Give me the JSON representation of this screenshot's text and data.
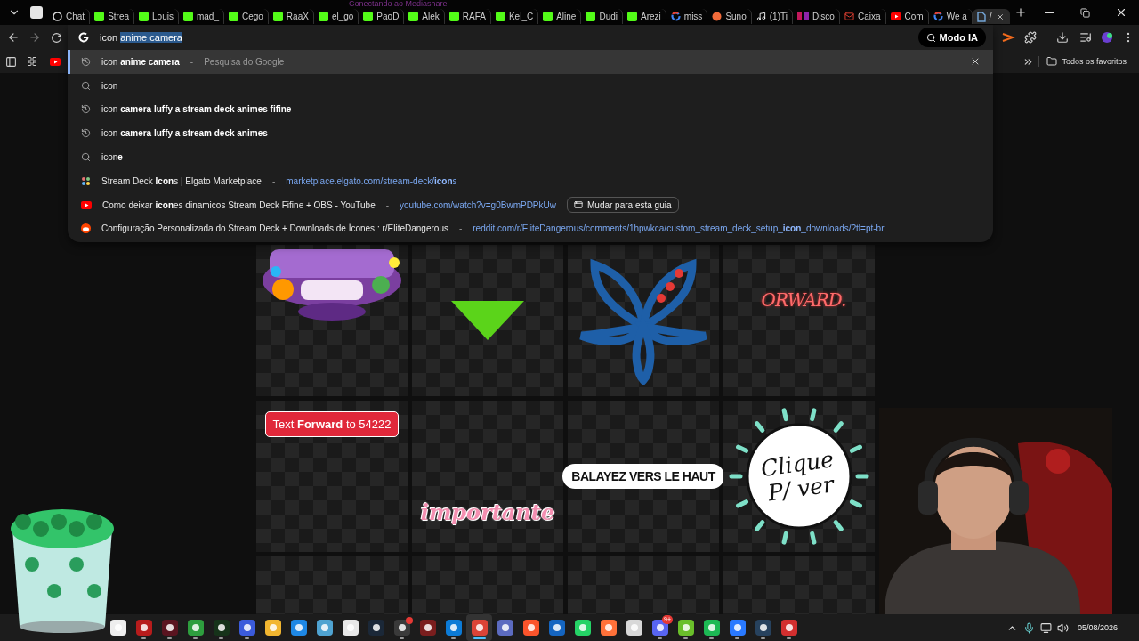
{
  "stream_overlay": {
    "notice": "Conectando ao Mediashare"
  },
  "tabs": [
    {
      "kind": "chatgpt",
      "title": "Chat",
      "selected": false
    },
    {
      "kind": "kick",
      "title": "Strea",
      "selected": false
    },
    {
      "kind": "kick",
      "title": "Louis",
      "selected": false
    },
    {
      "kind": "kick",
      "title": "mad_",
      "selected": false
    },
    {
      "kind": "kick",
      "title": "Cego",
      "selected": false
    },
    {
      "kind": "kick",
      "title": "RaaX",
      "selected": false
    },
    {
      "kind": "kick",
      "title": "el_go",
      "selected": false
    },
    {
      "kind": "kick",
      "title": "PaoD",
      "selected": false
    },
    {
      "kind": "kick",
      "title": "Alek",
      "selected": false
    },
    {
      "kind": "kick",
      "title": "RAFA",
      "selected": false
    },
    {
      "kind": "kick",
      "title": "Kel_C",
      "selected": false
    },
    {
      "kind": "kick",
      "title": "Aline",
      "selected": false
    },
    {
      "kind": "kick",
      "title": "Dudi",
      "selected": false
    },
    {
      "kind": "kick",
      "title": "Arezi",
      "selected": false
    },
    {
      "kind": "google",
      "title": "miss",
      "selected": false
    },
    {
      "kind": "suno",
      "title": "Suno",
      "selected": false
    },
    {
      "kind": "tiktok",
      "title": "(1)Ti",
      "selected": false
    },
    {
      "kind": "km",
      "title": "Disco",
      "selected": false
    },
    {
      "kind": "gmail",
      "title": "Caixa",
      "selected": false
    },
    {
      "kind": "youtube",
      "title": "Com",
      "selected": false
    },
    {
      "kind": "google",
      "title": "We a",
      "selected": false
    },
    {
      "kind": "doc",
      "title": "/",
      "selected": true
    }
  ],
  "omnibox": {
    "typed": "icon ",
    "completion": "anime camera",
    "ai_button": "Modo IA"
  },
  "suggestions": [
    {
      "kind": "history",
      "text": "icon **anime camera**",
      "dash": "-",
      "detail": "Pesquisa do Google",
      "selected": true
    },
    {
      "kind": "search",
      "text": "icon",
      "selected": false
    },
    {
      "kind": "history",
      "text": "icon **camera luffy a stream deck animes fifine**",
      "selected": false
    },
    {
      "kind": "history",
      "text": "icon **camera luffy a stream deck animes**",
      "selected": false
    },
    {
      "kind": "search",
      "text": "icon**e**",
      "selected": false
    },
    {
      "kind": "grid-site",
      "text": "Stream Deck **Icon**s | Elgato Marketplace",
      "dash": "-",
      "url": "marketplace.elgato.com/stream-deck/**icon**s",
      "selected": false
    },
    {
      "kind": "video-site",
      "text": "Como deixar **icon**es dinamicos Stream Deck Fifine + OBS - YouTube",
      "dash": "-",
      "url": "youtube.com/watch?v=g0BwmPDPkUw",
      "action": "Mudar para esta guia",
      "selected": false
    },
    {
      "kind": "forum-site",
      "text": "Configuração Personalizada do Stream Deck + Downloads de Ícones : r/EliteDangerous",
      "dash": "-",
      "url": "reddit.com/r/EliteDangerous/comments/1hpwkca/custom_stream_deck_setup_**icon**_downloads/?tl=pt-br",
      "selected": false
    }
  ],
  "bookmarks": {
    "all_bookmarks": "Todos os favoritos"
  },
  "tiles": [
    {
      "kind": "picture"
    },
    {
      "kind": "triangle"
    },
    {
      "kind": "flower"
    },
    {
      "kind": "neon",
      "text": "ORWARD."
    },
    {
      "kind": "tag",
      "text": "Text **Forward** to 54222"
    },
    {
      "kind": "script",
      "text": "importante"
    },
    {
      "kind": "pill",
      "text": "BALAYEZ VERS LE HAUT"
    },
    {
      "kind": "burst",
      "text": "Clique P/ ver"
    },
    {
      "kind": "empty"
    },
    {
      "kind": "empty"
    },
    {
      "kind": "empty"
    },
    {
      "kind": "empty"
    }
  ],
  "taskbar": {
    "apps": [
      {
        "color": "#eeeeee",
        "running": false,
        "selected": false,
        "alert": false
      },
      {
        "color": "#b71c1c",
        "running": true,
        "selected": false,
        "alert": false
      },
      {
        "color": "#5a1420",
        "running": true,
        "selected": false,
        "alert": false
      },
      {
        "color": "#2e9e3e",
        "running": true,
        "selected": false,
        "alert": false
      },
      {
        "color": "#16331a",
        "running": true,
        "selected": false,
        "alert": false
      },
      {
        "color": "#3b5bdb",
        "running": true,
        "selected": false,
        "alert": false
      },
      {
        "color": "#f2b630",
        "running": false,
        "selected": false,
        "alert": false
      },
      {
        "color": "#1e88e5",
        "running": false,
        "selected": false,
        "alert": false
      },
      {
        "color": "#4fa3d1",
        "running": false,
        "selected": false,
        "alert": false
      },
      {
        "color": "#e8e8e8",
        "running": false,
        "selected": false,
        "alert": false
      },
      {
        "color": "#1b2838",
        "running": false,
        "selected": false,
        "alert": false
      },
      {
        "color": "#3a3a3a",
        "running": true,
        "selected": false,
        "alert": true
      },
      {
        "color": "#7a1e1e",
        "running": false,
        "selected": false,
        "alert": false
      },
      {
        "color": "#0c7bd6",
        "running": true,
        "selected": false,
        "alert": false
      },
      {
        "color": "#db4437",
        "running": true,
        "selected": true,
        "alert": false
      },
      {
        "color": "#5c6bc0",
        "running": false,
        "selected": false,
        "alert": false
      },
      {
        "color": "#fb542b",
        "running": false,
        "selected": false,
        "alert": false
      },
      {
        "color": "#1565c0",
        "running": false,
        "selected": false,
        "alert": false
      },
      {
        "color": "#25d366",
        "running": false,
        "selected": false,
        "alert": false
      },
      {
        "color": "#ff7139",
        "running": false,
        "selected": false,
        "alert": false
      },
      {
        "color": "#d8d8d8",
        "running": false,
        "selected": false,
        "alert": false
      },
      {
        "color": "#5865f2",
        "running": true,
        "selected": false,
        "alert": false,
        "badge": "9+"
      },
      {
        "color": "#6abf2a",
        "running": true,
        "selected": false,
        "alert": false
      },
      {
        "color": "#1db954",
        "running": true,
        "selected": false,
        "alert": false
      },
      {
        "color": "#2979ff",
        "running": true,
        "selected": false,
        "alert": false
      },
      {
        "color": "#27425e",
        "running": true,
        "selected": false,
        "alert": false
      },
      {
        "color": "#d32f2f",
        "running": true,
        "selected": false,
        "alert": false
      }
    ],
    "date": "05/08/2026"
  }
}
